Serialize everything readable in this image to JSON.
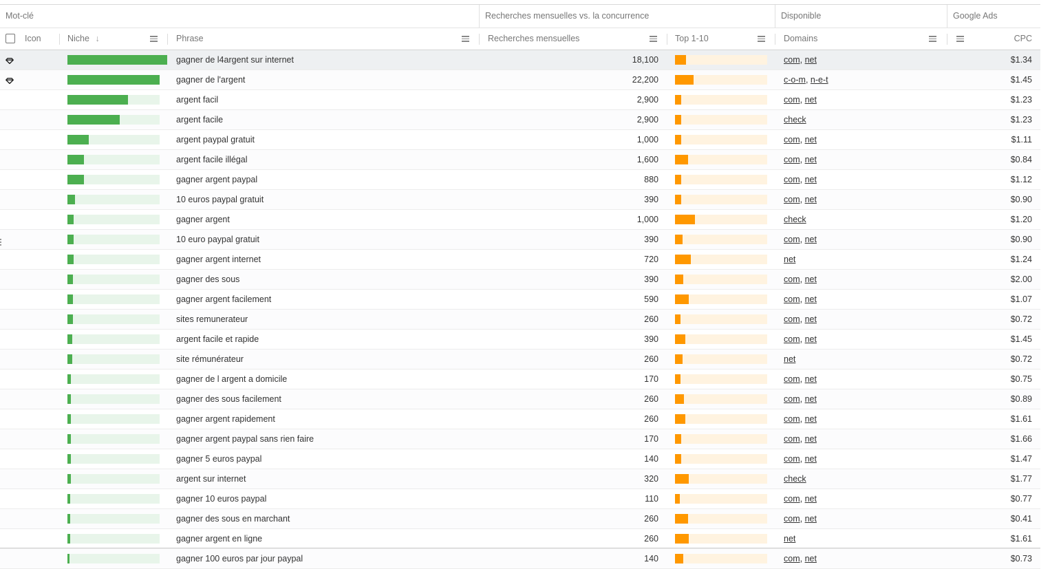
{
  "group_headers": {
    "keyword": "Mot-clé",
    "searches_vs_competition": "Recherches mensuelles vs. la concurrence",
    "available": "Disponible",
    "google_ads": "Google Ads"
  },
  "column_headers": {
    "icon": "Icon",
    "niche": "Niche",
    "sort_indicator": "↓",
    "phrase": "Phrase",
    "monthly_searches": "Recherches mensuelles",
    "top": "Top 1-10",
    "domains": "Domains",
    "cpc": "CPC"
  },
  "colors": {
    "niche_bar": "#4caf50",
    "niche_track": "#e8f5ea",
    "top_bar": "#ff9800",
    "top_track": "#fff3e0"
  },
  "rows": [
    {
      "icon": "gem-icon",
      "niche": 1.0,
      "phrase": "gagner de l4argent sur internet",
      "searches": "18,100",
      "top": 0.12,
      "domains": [
        "com",
        "net"
      ],
      "cpc": "$1.34",
      "selected": true
    },
    {
      "icon": "gem-icon",
      "niche": 1.0,
      "phrase": "gagner de l'argent",
      "searches": "22,200",
      "top": 0.2,
      "domains": [
        "c-o-m",
        "n-e-t"
      ],
      "cpc": "$1.45"
    },
    {
      "icon": "",
      "niche": 0.66,
      "phrase": "argent facil",
      "searches": "2,900",
      "top": 0.07,
      "domains": [
        "com",
        "net"
      ],
      "cpc": "$1.23"
    },
    {
      "icon": "",
      "niche": 0.57,
      "phrase": "argent facile",
      "searches": "2,900",
      "top": 0.07,
      "domains": [
        "check"
      ],
      "cpc": "$1.23"
    },
    {
      "icon": "",
      "niche": 0.23,
      "phrase": "argent paypal gratuit",
      "searches": "1,000",
      "top": 0.07,
      "domains": [
        "com",
        "net"
      ],
      "cpc": "$1.11"
    },
    {
      "icon": "",
      "niche": 0.18,
      "phrase": "argent facile illégal",
      "searches": "1,600",
      "top": 0.14,
      "domains": [
        "com",
        "net"
      ],
      "cpc": "$0.84"
    },
    {
      "icon": "",
      "niche": 0.18,
      "phrase": "gagner argent paypal",
      "searches": "880",
      "top": 0.07,
      "domains": [
        "com",
        "net"
      ],
      "cpc": "$1.12"
    },
    {
      "icon": "",
      "niche": 0.08,
      "phrase": "10 euros paypal gratuit",
      "searches": "390",
      "top": 0.07,
      "domains": [
        "com",
        "net"
      ],
      "cpc": "$0.90"
    },
    {
      "icon": "",
      "niche": 0.07,
      "phrase": "gagner argent",
      "searches": "1,000",
      "top": 0.22,
      "domains": [
        "check"
      ],
      "cpc": "$1.20"
    },
    {
      "icon": "",
      "niche": 0.07,
      "phrase": "10 euro paypal gratuit",
      "searches": "390",
      "top": 0.08,
      "domains": [
        "com",
        "net"
      ],
      "cpc": "$0.90"
    },
    {
      "icon": "",
      "niche": 0.07,
      "phrase": "gagner argent internet",
      "searches": "720",
      "top": 0.17,
      "domains": [
        "net"
      ],
      "cpc": "$1.24"
    },
    {
      "icon": "",
      "niche": 0.06,
      "phrase": "gagner des sous",
      "searches": "390",
      "top": 0.09,
      "domains": [
        "com",
        "net"
      ],
      "cpc": "$2.00"
    },
    {
      "icon": "",
      "niche": 0.06,
      "phrase": "gagner argent facilement",
      "searches": "590",
      "top": 0.15,
      "domains": [
        "com",
        "net"
      ],
      "cpc": "$1.07"
    },
    {
      "icon": "",
      "niche": 0.06,
      "phrase": "sites remunerateur",
      "searches": "260",
      "top": 0.06,
      "domains": [
        "com",
        "net"
      ],
      "cpc": "$0.72"
    },
    {
      "icon": "",
      "niche": 0.05,
      "phrase": "argent facile et rapide",
      "searches": "390",
      "top": 0.11,
      "domains": [
        "com",
        "net"
      ],
      "cpc": "$1.45"
    },
    {
      "icon": "",
      "niche": 0.05,
      "phrase": "site rémunérateur",
      "searches": "260",
      "top": 0.08,
      "domains": [
        "net"
      ],
      "cpc": "$0.72"
    },
    {
      "icon": "",
      "niche": 0.04,
      "phrase": "gagner de l argent a domicile",
      "searches": "170",
      "top": 0.06,
      "domains": [
        "com",
        "net"
      ],
      "cpc": "$0.75"
    },
    {
      "icon": "",
      "niche": 0.04,
      "phrase": "gagner des sous facilement",
      "searches": "260",
      "top": 0.1,
      "domains": [
        "com",
        "net"
      ],
      "cpc": "$0.89"
    },
    {
      "icon": "",
      "niche": 0.04,
      "phrase": "gagner argent rapidement",
      "searches": "260",
      "top": 0.11,
      "domains": [
        "com",
        "net"
      ],
      "cpc": "$1.61"
    },
    {
      "icon": "",
      "niche": 0.04,
      "phrase": "gagner argent paypal sans rien faire",
      "searches": "170",
      "top": 0.07,
      "domains": [
        "com",
        "net"
      ],
      "cpc": "$1.66"
    },
    {
      "icon": "",
      "niche": 0.04,
      "phrase": "gagner 5 euros paypal",
      "searches": "140",
      "top": 0.07,
      "domains": [
        "com",
        "net"
      ],
      "cpc": "$1.47"
    },
    {
      "icon": "",
      "niche": 0.04,
      "phrase": "argent sur internet",
      "searches": "320",
      "top": 0.15,
      "domains": [
        "check"
      ],
      "cpc": "$1.77"
    },
    {
      "icon": "",
      "niche": 0.03,
      "phrase": "gagner 10 euros paypal",
      "searches": "110",
      "top": 0.05,
      "domains": [
        "com",
        "net"
      ],
      "cpc": "$0.77"
    },
    {
      "icon": "",
      "niche": 0.03,
      "phrase": "gagner des sous en marchant",
      "searches": "260",
      "top": 0.14,
      "domains": [
        "com",
        "net"
      ],
      "cpc": "$0.41"
    },
    {
      "icon": "",
      "niche": 0.03,
      "phrase": "gagner argent en ligne",
      "searches": "260",
      "top": 0.15,
      "domains": [
        "net"
      ],
      "cpc": "$1.61"
    },
    {
      "icon": "",
      "niche": 0.025,
      "phrase": "gagner 100 euros par jour paypal",
      "searches": "140",
      "top": 0.09,
      "domains": [
        "com",
        "net"
      ],
      "cpc": "$0.73"
    }
  ]
}
